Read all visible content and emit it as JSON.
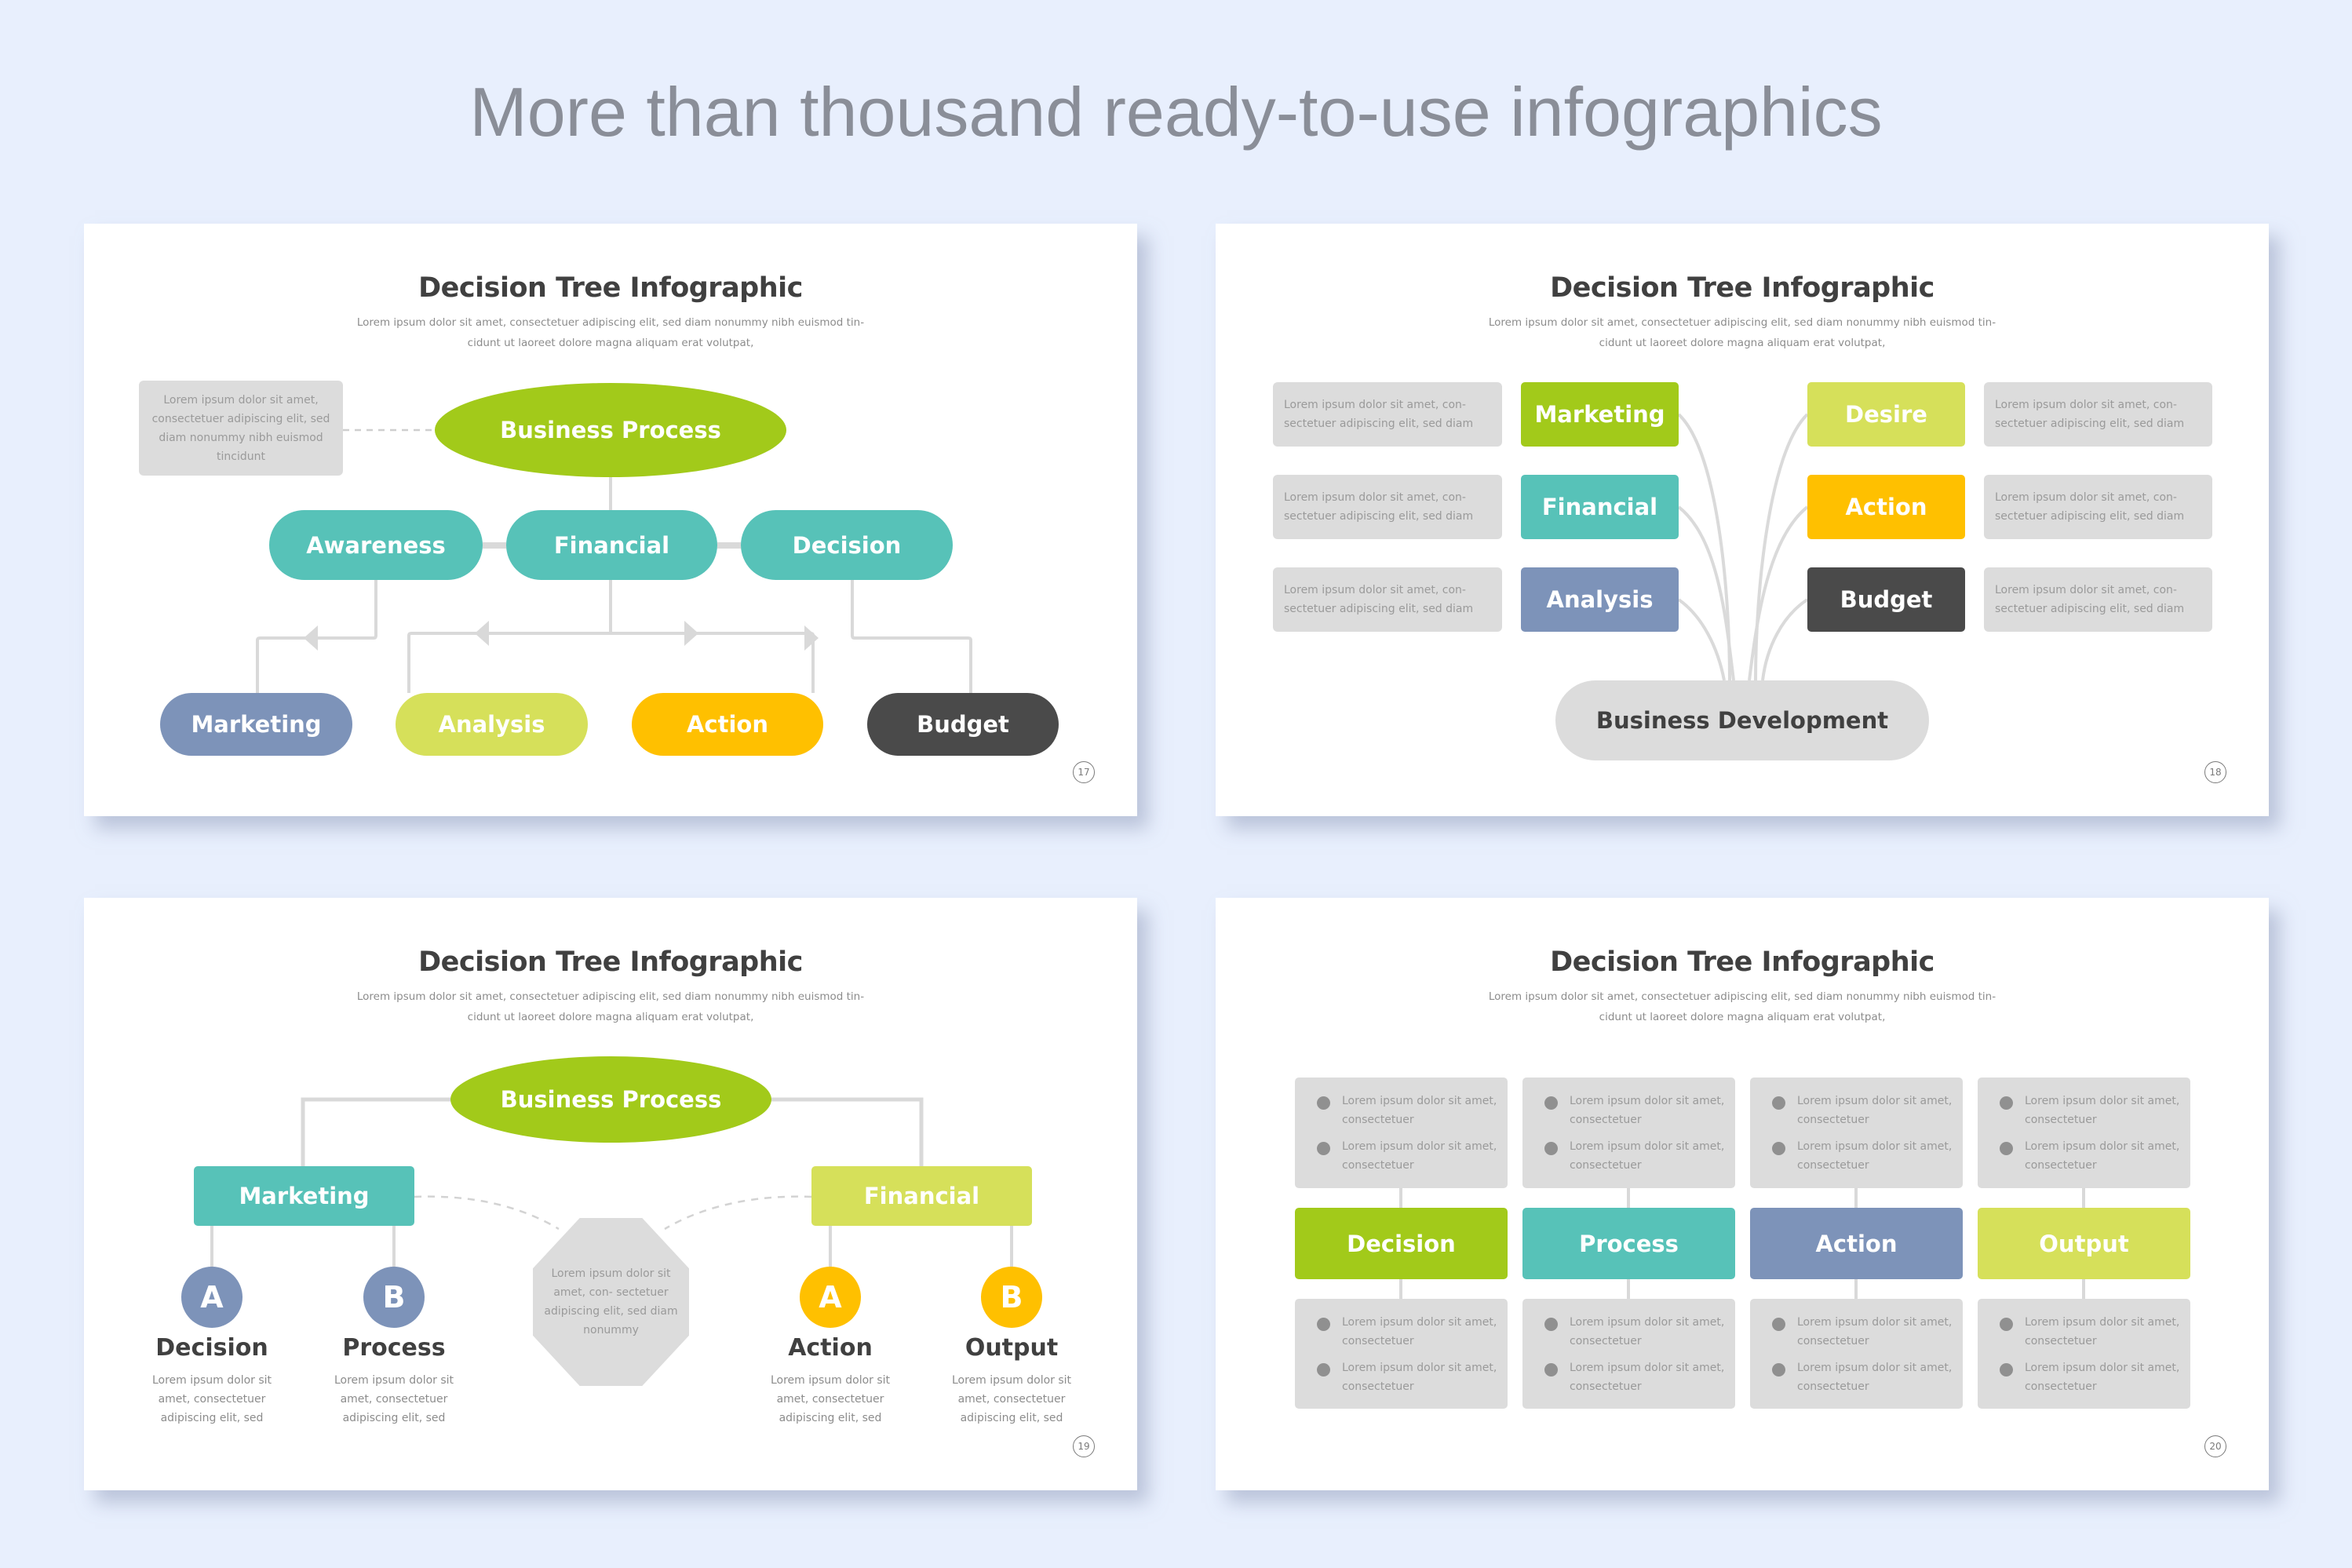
{
  "headline": "More than thousand ready-to-use infographics",
  "colors": {
    "page_bg": "#e8effd",
    "lime_green": "#a2ca1a",
    "teal": "#57c2b8",
    "slate_blue": "#7d93b9",
    "yellow_green": "#d6e05a",
    "amber": "#ffc000",
    "charcoal": "#4a4a4a",
    "light_gray": "#dcdcdc",
    "connector_gray": "#d9d9d9"
  },
  "slides": [
    {
      "title": "Decision Tree Infographic",
      "subtitle_line1": "Lorem ipsum dolor sit amet, consectetuer adipiscing elit, sed diam nonummy nibh euismod tin-",
      "subtitle_line2": "cidunt ut laoreet dolore magna aliquam erat volutpat,",
      "page_number": "17",
      "note_box": "Lorem ipsum dolor sit amet, consectetuer adipiscing elit, sed diam nonummy nibh euismod tincidunt",
      "root": "Business Process",
      "middle": [
        "Awareness",
        "Financial",
        "Decision"
      ],
      "leaves": [
        "Marketing",
        "Analysis",
        "Action",
        "Budget"
      ]
    },
    {
      "title": "Decision Tree Infographic",
      "subtitle_line1": "Lorem ipsum dolor sit amet, consectetuer adipiscing elit, sed diam nonummy nibh euismod tin-",
      "subtitle_line2": "cidunt ut laoreet dolore magna aliquam erat volutpat,",
      "page_number": "18",
      "root": "Business Development",
      "left_items": [
        {
          "label": "Marketing",
          "text": "Lorem ipsum dolor sit amet, con- sectetuer adipiscing elit, sed diam"
        },
        {
          "label": "Financial",
          "text": "Lorem ipsum dolor sit amet, con- sectetuer adipiscing elit, sed diam"
        },
        {
          "label": "Analysis",
          "text": "Lorem ipsum dolor sit amet, con- sectetuer adipiscing elit, sed diam"
        }
      ],
      "right_items": [
        {
          "label": "Desire",
          "text": "Lorem ipsum dolor sit amet, con- sectetuer adipiscing elit, sed diam"
        },
        {
          "label": "Action",
          "text": "Lorem ipsum dolor sit amet, con- sectetuer adipiscing elit, sed diam"
        },
        {
          "label": "Budget",
          "text": "Lorem ipsum dolor sit amet, con- sectetuer adipiscing elit, sed diam"
        }
      ]
    },
    {
      "title": "Decision Tree Infographic",
      "subtitle_line1": "Lorem ipsum dolor sit amet, consectetuer adipiscing elit, sed diam nonummy nibh euismod tin-",
      "subtitle_line2": "cidunt ut laoreet dolore magna aliquam erat volutpat,",
      "page_number": "19",
      "root": "Business Process",
      "branches": [
        "Marketing",
        "Financial"
      ],
      "center_note": "Lorem ipsum dolor sit amet, con- sectetuer adipiscing elit, sed diam nonummy",
      "options": [
        {
          "letter": "A",
          "label": "Decision",
          "desc": "Lorem ipsum dolor sit amet, consectetuer adipiscing elit, sed"
        },
        {
          "letter": "B",
          "label": "Process",
          "desc": "Lorem ipsum dolor sit amet, consectetuer adipiscing elit, sed"
        },
        {
          "letter": "A",
          "label": "Action",
          "desc": "Lorem ipsum dolor sit amet, consectetuer adipiscing elit, sed"
        },
        {
          "letter": "B",
          "label": "Output",
          "desc": "Lorem ipsum dolor sit amet, consectetuer adipiscing elit, sed"
        }
      ]
    },
    {
      "title": "Decision Tree Infographic",
      "subtitle_line1": "Lorem ipsum dolor sit amet, consectetuer adipiscing elit, sed diam nonummy nibh euismod tin-",
      "subtitle_line2": "cidunt ut laoreet dolore magna aliquam erat volutpat,",
      "page_number": "20",
      "columns": [
        {
          "label": "Decision",
          "top": [
            "Lorem ipsum dolor sit amet, consectetuer",
            "Lorem ipsum dolor sit amet, consectetuer"
          ],
          "bottom": [
            "Lorem ipsum dolor sit amet, consectetuer",
            "Lorem ipsum dolor sit amet, consectetuer"
          ]
        },
        {
          "label": "Process",
          "top": [
            "Lorem ipsum dolor sit amet, consectetuer",
            "Lorem ipsum dolor sit amet, consectetuer"
          ],
          "bottom": [
            "Lorem ipsum dolor sit amet, consectetuer",
            "Lorem ipsum dolor sit amet, consectetuer"
          ]
        },
        {
          "label": "Action",
          "top": [
            "Lorem ipsum dolor sit amet, consectetuer",
            "Lorem ipsum dolor sit amet, consectetuer"
          ],
          "bottom": [
            "Lorem ipsum dolor sit amet, consectetuer",
            "Lorem ipsum dolor sit amet, consectetuer"
          ]
        },
        {
          "label": "Output",
          "top": [
            "Lorem ipsum dolor sit amet, consectetuer",
            "Lorem ipsum dolor sit amet, consectetuer"
          ],
          "bottom": [
            "Lorem ipsum dolor sit amet, consectetuer",
            "Lorem ipsum dolor sit amet, consectetuer"
          ]
        }
      ]
    }
  ]
}
